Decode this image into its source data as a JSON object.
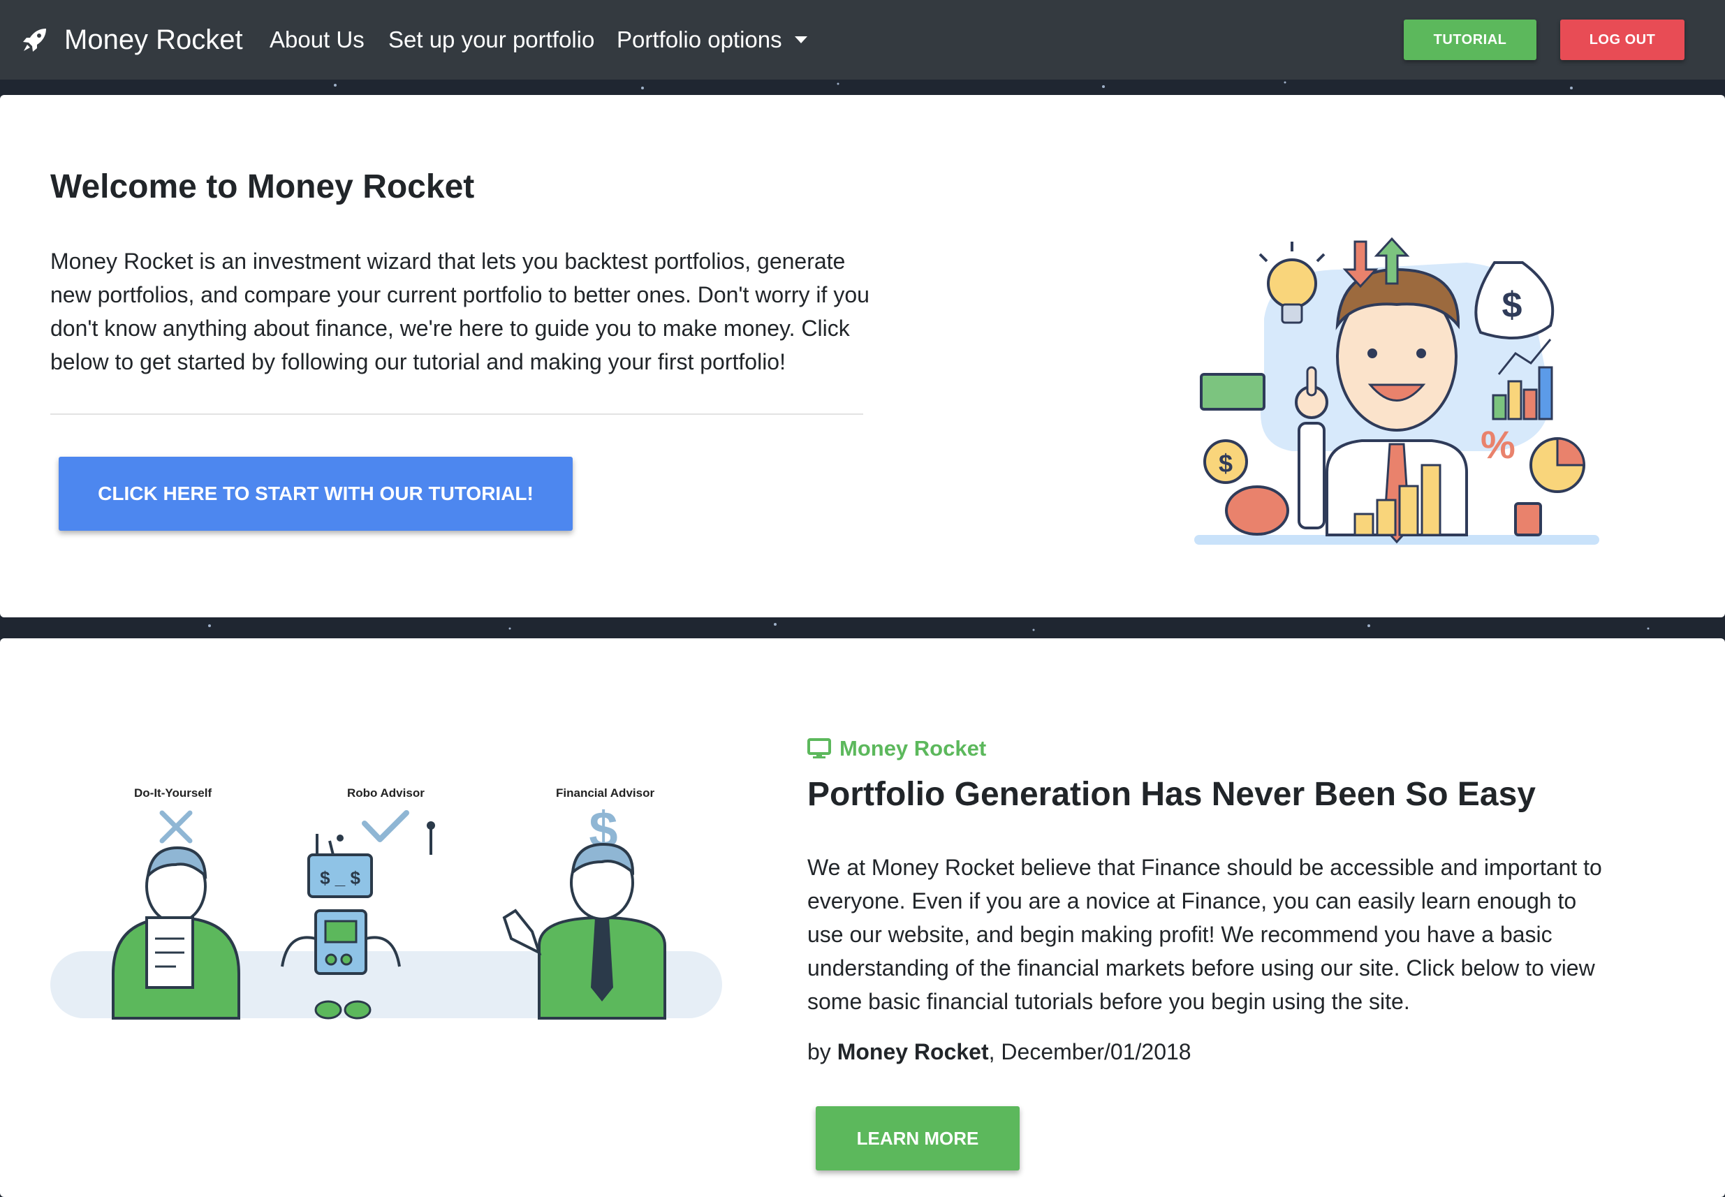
{
  "navbar": {
    "brand": "Money Rocket",
    "brand_icon": "rocket-icon",
    "links": [
      "About Us",
      "Set up your portfolio",
      "Portfolio options"
    ],
    "tutorial_label": "TUTORIAL",
    "logout_label": "LOG OUT"
  },
  "hero": {
    "title": "Welcome to Money Rocket",
    "text": "Money Rocket is an investment wizard that lets you backtest portfolios, generate new portfolios, and compare your current portfolio to better ones. Don't worry if you don't know anything about finance, we're here to guide you to make money. Click below to get started by following our tutorial and making your first portfolio!",
    "cta_label": "CLICK HERE TO START WITH OUR TUTORIAL!"
  },
  "feature": {
    "advisor_labels": [
      "Do-It-Yourself",
      "Robo Advisor",
      "Financial Advisor"
    ],
    "eyebrow": "Money Rocket",
    "eyebrow_icon": "desktop-icon",
    "title": "Portfolio Generation Has Never Been So Easy",
    "text": "We at Money Rocket believe that Finance should be accessible and important to everyone. Even if you are a novice at Finance, you can easily learn enough to use our website, and begin making profit! We recommend you have a basic understanding of the financial markets before using our site. Click below to view some basic financial tutorials before you begin using the site.",
    "byline_prefix": "by",
    "byline_author": "Money Rocket",
    "byline_date": ", December/01/2018",
    "learn_more_label": "LEARN MORE"
  },
  "colors": {
    "navbar": "#343a40",
    "tutorial_green": "#5cb85c",
    "logout_red": "#e84c55",
    "cta_blue": "#4d87ef"
  }
}
